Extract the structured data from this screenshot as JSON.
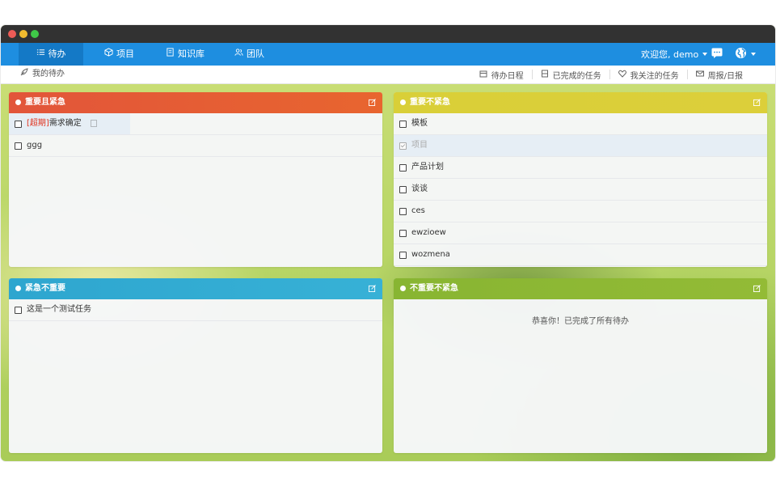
{
  "nav": {
    "items": [
      {
        "label": "待办",
        "icon": "list-icon"
      },
      {
        "label": "项目",
        "icon": "cube-icon"
      },
      {
        "label": "知识库",
        "icon": "book-icon"
      },
      {
        "label": "团队",
        "icon": "team-icon"
      }
    ],
    "welcome": "欢迎您, demo"
  },
  "subbar": {
    "crumb": "我的待办",
    "links": [
      "待办日程",
      "已完成的任务",
      "我关注的任务",
      "周报/日报"
    ]
  },
  "panels": {
    "urgent_important": {
      "title": "重要且紧急",
      "tasks": [
        {
          "tag": "[超期]",
          "label": "需求确定"
        },
        {
          "label": "ggg"
        }
      ]
    },
    "important_not_urgent": {
      "title": "重要不紧急",
      "tasks": [
        {
          "label": "模板"
        },
        {
          "label": "项目",
          "done": true
        },
        {
          "label": "产品计划"
        },
        {
          "label": "谈谈"
        },
        {
          "label": "ces"
        },
        {
          "label": "ewzioew"
        },
        {
          "label": "wozmena"
        }
      ]
    },
    "urgent_not_important": {
      "title": "紧急不重要",
      "tasks": [
        {
          "label": "这是一个测试任务"
        }
      ]
    },
    "not_important_not_urgent": {
      "title": "不重要不紧急",
      "empty_text": "恭喜你！已完成了所有待办"
    }
  },
  "colors": {
    "nav": "#1e8ee0",
    "red": "#e2553a",
    "yellow": "#d9cf38",
    "blue": "#2ea6cf",
    "green": "#88b532"
  }
}
